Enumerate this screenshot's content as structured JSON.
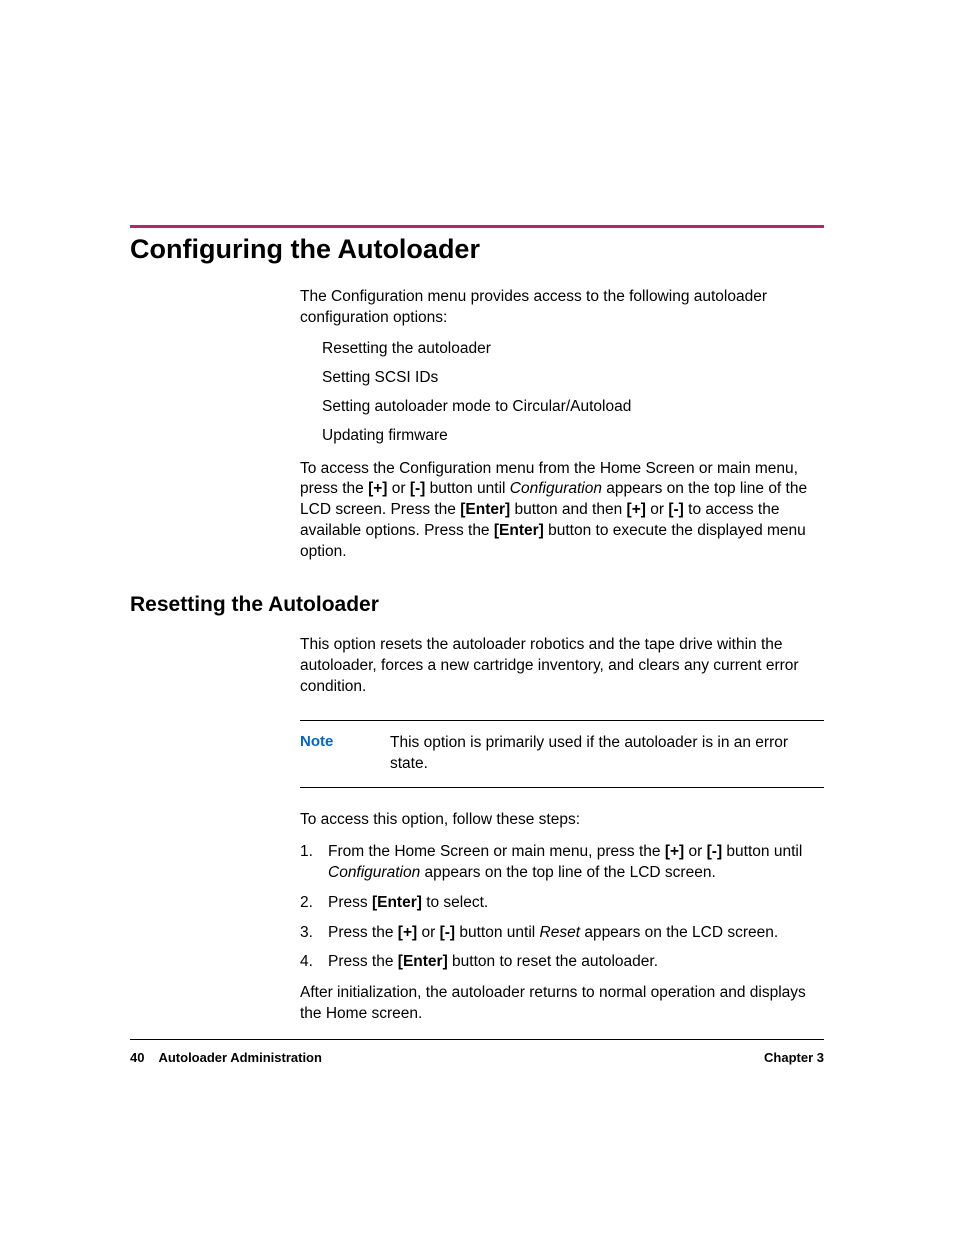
{
  "heading1": "Configuring the Autoloader",
  "intro": "The Configuration menu provides access to the following autoloader configuration options:",
  "options": [
    "Resetting the autoloader",
    "Setting SCSI IDs",
    "Setting autoloader mode to Circular/Autoload",
    "Updating firmware"
  ],
  "access": {
    "pre1": "To access the Configuration menu from the Home Screen or main menu, press the ",
    "plus": "[+]",
    "or1": " or ",
    "minus": "[-]",
    "mid1": " button until ",
    "config": "Configuration",
    "mid2": " appears on the top line of the LCD screen. Press the ",
    "enter1": "[Enter]",
    "mid3": " button and then ",
    "plus2": "[+]",
    "or2": " or ",
    "minus2": "[-]",
    "mid4": " to access the available options. Press the ",
    "enter2": "[Enter]",
    "end": " button to execute the displayed menu option."
  },
  "heading2": "Resetting the Autoloader",
  "reset_intro": "This option resets the autoloader robotics and the tape drive within the autoloader, forces a new cartridge inventory, and clears any current error condition.",
  "note": {
    "label": "Note",
    "text": "This option is primarily used if the autoloader is in an error state."
  },
  "steps_intro": "To access this option, follow these steps:",
  "step1": {
    "pre": "From the Home Screen or main menu, press the ",
    "plus": "[+]",
    "or": " or ",
    "minus": "[-]",
    "mid": " button until ",
    "config": "Configuration",
    "end": " appears on the top line of the LCD screen."
  },
  "step2": {
    "pre": "Press ",
    "enter": "[Enter]",
    "end": " to select."
  },
  "step3": {
    "pre": "Press the ",
    "plus": "[+]",
    "or": " or ",
    "minus": "[-]",
    "mid": " button until ",
    "reset": "Reset",
    "end": " appears on the LCD screen."
  },
  "step4": {
    "pre": "Press the ",
    "enter": "[Enter]",
    "end": " button to reset the autoloader."
  },
  "outro": "After initialization, the autoloader returns to normal operation and displays the Home screen.",
  "footer": {
    "page": "40",
    "title": "Autoloader Administration",
    "chapter": "Chapter 3"
  }
}
